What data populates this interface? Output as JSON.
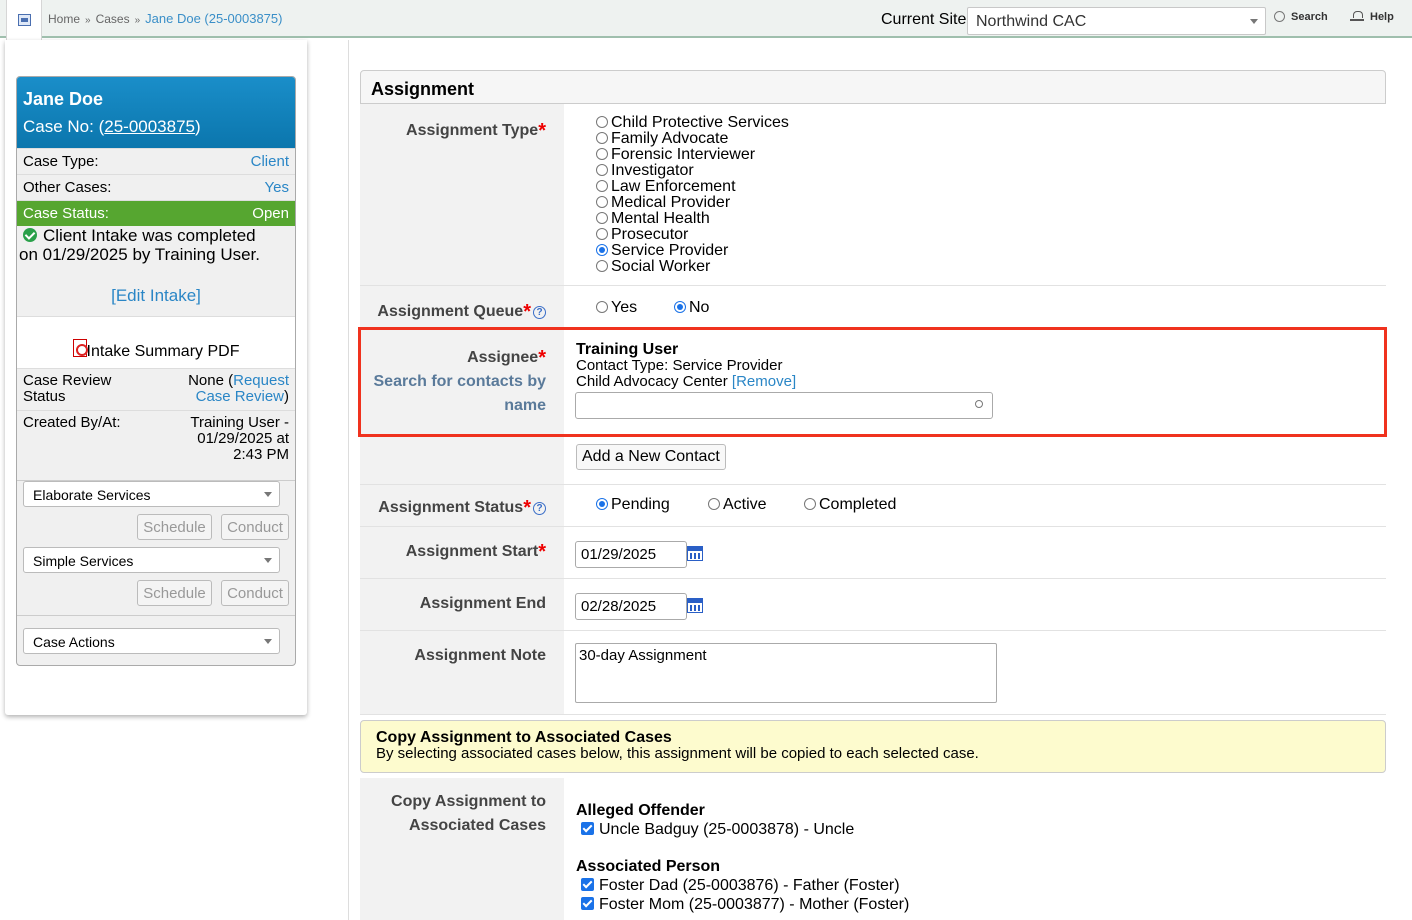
{
  "topbar": {
    "breadcrumbs": [
      "Home",
      "Cases"
    ],
    "breadcrumb_sep": "»",
    "current": "Jane Doe (25-0003875)",
    "current_site_label": "Current Site",
    "current_site_value": "Northwind CAC",
    "search_label": "Search",
    "help_label": "Help"
  },
  "sidebar": {
    "name": "Jane Doe",
    "case_no_label": "Case No: (",
    "case_no": "25-0003875",
    "case_no_close": ")",
    "case_type_label": "Case Type:",
    "case_type_value": "Client",
    "other_cases_label": "Other Cases:",
    "other_cases_value": "Yes",
    "case_status_label": "Case Status:",
    "case_status_value": "Open",
    "intake_line1": "Client Intake was completed",
    "intake_line2": "on 01/29/2025 by Training User.",
    "edit_intake": "[Edit Intake]",
    "pdf_label": "Intake Summary PDF",
    "review_label": "Case Review Status",
    "review_none": "None (",
    "review_link": "Request Case Review",
    "review_close": ")",
    "created_label": "Created By/At:",
    "created_value": "Training User - 01/29/2025 at 2:43 PM",
    "elaborate_services": "Elaborate Services",
    "simple_services": "Simple Services",
    "schedule_label": "Schedule",
    "conduct_label": "Conduct",
    "case_actions": "Case Actions"
  },
  "form": {
    "title": "Assignment",
    "assignment_type_label": "Assignment Type",
    "assignment_types": [
      {
        "label": "Child Protective Services",
        "selected": false
      },
      {
        "label": "Family Advocate",
        "selected": false
      },
      {
        "label": "Forensic Interviewer",
        "selected": false
      },
      {
        "label": "Investigator",
        "selected": false
      },
      {
        "label": "Law Enforcement",
        "selected": false
      },
      {
        "label": "Medical Provider",
        "selected": false
      },
      {
        "label": "Mental Health",
        "selected": false
      },
      {
        "label": "Prosecutor",
        "selected": false
      },
      {
        "label": "Service Provider",
        "selected": true
      },
      {
        "label": "Social Worker",
        "selected": false
      }
    ],
    "queue_label": "Assignment Queue",
    "queue_yes": "Yes",
    "queue_no": "No",
    "queue_selected": "No",
    "assignee_label": "Assignee",
    "assignee_hint": "Search for contacts by name",
    "assignee_name": "Training User",
    "assignee_type": "Contact Type: Service Provider",
    "assignee_org": "Child Advocacy Center",
    "remove_label": "[Remove]",
    "add_contact": "Add a New Contact",
    "status_label": "Assignment Status",
    "status_pending": "Pending",
    "status_active": "Active",
    "status_completed": "Completed",
    "status_selected": "Pending",
    "start_label": "Assignment Start",
    "start_value": "01/29/2025",
    "end_label": "Assignment End",
    "end_value": "02/28/2025",
    "note_label": "Assignment Note",
    "note_value": "30-day Assignment",
    "copy_title": "Copy Assignment to Associated Cases",
    "copy_desc": "By selecting associated cases below, this assignment will be copied to each selected case.",
    "copy_label": "Copy Assignment to Associated Cases",
    "offender_heading": "Alleged Offender",
    "offender_items": [
      "Uncle Badguy (25-0003878) - Uncle"
    ],
    "person_heading": "Associated Person",
    "person_items": [
      "Foster Dad (25-0003876) - Father (Foster)",
      "Foster Mom (25-0003877) - Mother (Foster)"
    ]
  },
  "colors": {
    "accent": "#2a86c6",
    "status_green": "#56a630",
    "highlight": "#f0321e",
    "header_blue": "#0b76ad"
  }
}
